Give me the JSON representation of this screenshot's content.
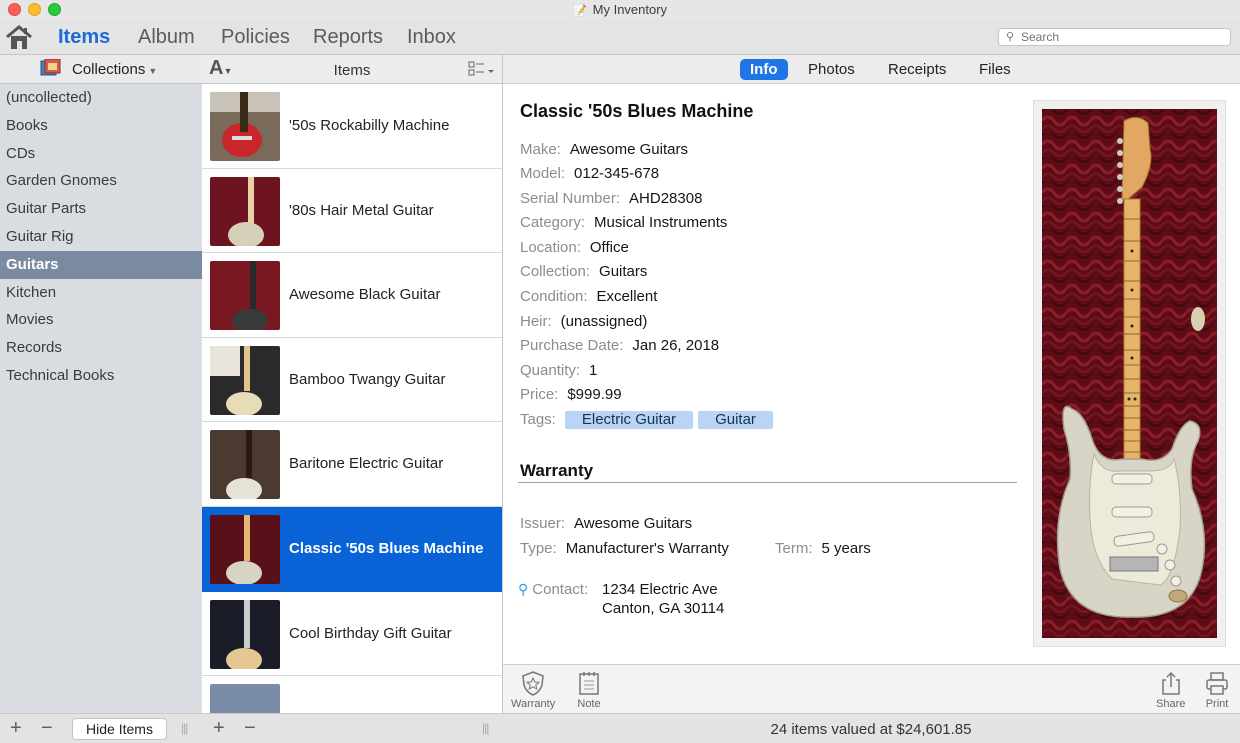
{
  "window": {
    "title": "My Inventory"
  },
  "toolbar": {
    "tabs": [
      "Items",
      "Album",
      "Policies",
      "Reports",
      "Inbox"
    ],
    "active_tab": "Items",
    "search_placeholder": "Search"
  },
  "sidebar": {
    "header": "Collections",
    "items": [
      "(uncollected)",
      "Books",
      "CDs",
      "Garden Gnomes",
      "Guitar Parts",
      "Guitar Rig",
      "Guitars",
      "Kitchen",
      "Movies",
      "Records",
      "Technical Books"
    ],
    "selected": "Guitars"
  },
  "list": {
    "sort_label": "A",
    "header": "Items",
    "items": [
      {
        "name": "'50s Rockabilly Machine"
      },
      {
        "name": "'80s Hair Metal Guitar"
      },
      {
        "name": "Awesome Black Guitar"
      },
      {
        "name": "Bamboo Twangy Guitar"
      },
      {
        "name": "Baritone Electric Guitar"
      },
      {
        "name": "Classic '50s Blues Machine"
      },
      {
        "name": "Cool Birthday Gift Guitar"
      }
    ],
    "selected": "Classic '50s Blues Machine"
  },
  "detail": {
    "tabs": [
      "Info",
      "Photos",
      "Receipts",
      "Files"
    ],
    "active_tab": "Info",
    "title": "Classic '50s Blues Machine",
    "fields": [
      {
        "label": "Make:",
        "value": "Awesome Guitars"
      },
      {
        "label": "Model:",
        "value": "012-345-678"
      },
      {
        "label": "Serial Number:",
        "value": "AHD28308"
      },
      {
        "label": "Category:",
        "value": "Musical Instruments"
      },
      {
        "label": "Location:",
        "value": "Office"
      },
      {
        "label": "Collection:",
        "value": "Guitars"
      },
      {
        "label": "Condition:",
        "value": "Excellent"
      },
      {
        "label": "Heir:",
        "value": "(unassigned)"
      },
      {
        "label": "Purchase Date:",
        "value": "Jan 26, 2018"
      },
      {
        "label": "Quantity:",
        "value": "1"
      },
      {
        "label": "Price:",
        "value": "$999.99"
      }
    ],
    "tags_label": "Tags:",
    "tags": [
      "Electric Guitar",
      "Guitar"
    ],
    "warranty": {
      "heading": "Warranty",
      "issuer_label": "Issuer:",
      "issuer": "Awesome Guitars",
      "type_label": "Type:",
      "type": "Manufacturer's Warranty",
      "term_label": "Term:",
      "term": "5 years",
      "contact_label": "Contact:",
      "contact_line1": "1234 Electric Ave",
      "contact_line2": "Canton, GA 30114"
    },
    "actions": {
      "warranty": "Warranty",
      "note": "Note",
      "share": "Share",
      "print": "Print"
    }
  },
  "statusbar": {
    "hide_items_label": "Hide Items",
    "summary": "24 items valued at $24,601.85"
  },
  "colors": {
    "accent": "#1d6ad8",
    "selection": "#0a63d6",
    "sidebar_selection": "#7a8aa0",
    "tag": "#b9d4f6"
  }
}
